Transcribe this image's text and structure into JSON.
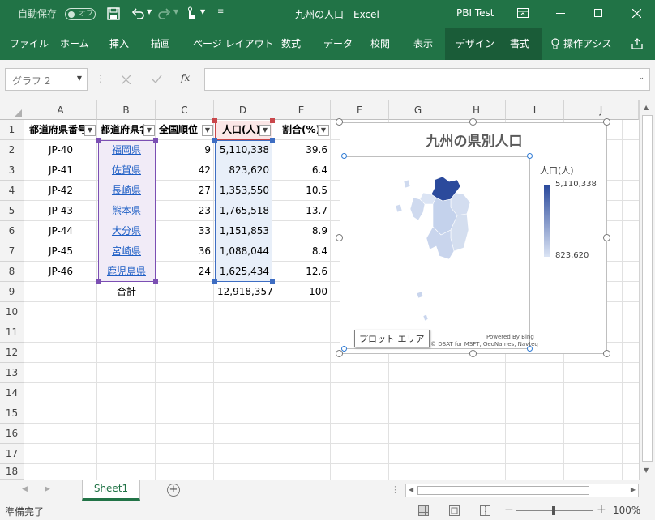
{
  "title_bar": {
    "autosave_label": "自動保存",
    "autosave_state": "オフ",
    "doc_title": "九州の人口",
    "app_name": "Excel",
    "context_group": "PBI Test"
  },
  "ribbon": {
    "tabs": [
      "ファイル",
      "ホーム",
      "挿入",
      "描画",
      "ページ レイアウト",
      "数式",
      "データ",
      "校閲",
      "表示",
      "デザイン",
      "書式"
    ],
    "tell_me": "操作アシス"
  },
  "formula_bar": {
    "name_box": "グラフ 2",
    "fx_label": "fx",
    "formula": ""
  },
  "columns": [
    "A",
    "B",
    "C",
    "D",
    "E",
    "F",
    "G",
    "H",
    "I",
    "J"
  ],
  "rows": [
    "1",
    "2",
    "3",
    "4",
    "5",
    "6",
    "7",
    "8",
    "9",
    "10",
    "11",
    "12",
    "13",
    "14",
    "15",
    "16",
    "17",
    "18"
  ],
  "table": {
    "headers": [
      "都道府県番号",
      "都道府県名",
      "全国順位",
      "人口(人)",
      "割合(%)"
    ],
    "records": [
      [
        "JP-40",
        "福岡県",
        "9",
        "5,110,338",
        "39.6"
      ],
      [
        "JP-41",
        "佐賀県",
        "42",
        "823,620",
        "6.4"
      ],
      [
        "JP-42",
        "長崎県",
        "27",
        "1,353,550",
        "10.5"
      ],
      [
        "JP-43",
        "熊本県",
        "23",
        "1,765,518",
        "13.7"
      ],
      [
        "JP-44",
        "大分県",
        "33",
        "1,151,853",
        "8.9"
      ],
      [
        "JP-45",
        "宮崎県",
        "36",
        "1,088,044",
        "8.4"
      ],
      [
        "JP-46",
        "鹿児島県",
        "24",
        "1,625,434",
        "12.6"
      ]
    ],
    "total_label": "合計",
    "total_population": "12,918,357",
    "total_ratio": "100"
  },
  "chart": {
    "title": "九州の県別人口",
    "legend_title": "人口(人)",
    "legend_max": "5,110,338",
    "legend_min": "823,620",
    "tooltip": "プロット エリア",
    "credit1": "Powered By Bing",
    "credit2": "© DSAT for MSFT, GeoNames, Navteq"
  },
  "sheet_tabs": {
    "active": "Sheet1"
  },
  "status": {
    "ready": "準備完了",
    "zoom": "100%"
  },
  "colors": {
    "excel_green": "#217346",
    "map_max": "#2b4a9c",
    "map_min": "#dbe4f4"
  }
}
